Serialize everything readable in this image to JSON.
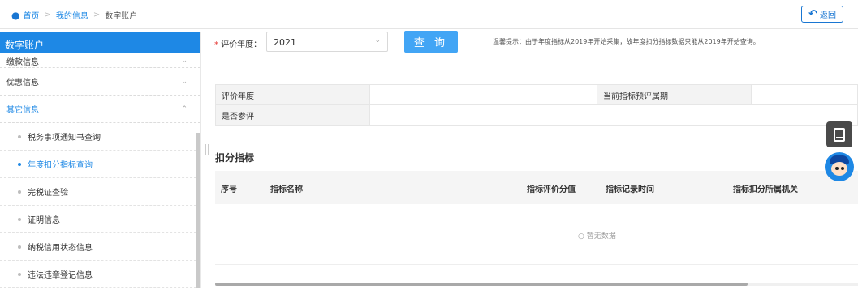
{
  "breadcrumb": {
    "home": "首页",
    "my_info": "我的信息",
    "current": "数字账户",
    "sep": ">"
  },
  "back_button": {
    "label": "返回"
  },
  "sidebar": {
    "title": "数字账户",
    "groups": [
      {
        "label": "缴款信息"
      },
      {
        "label": "优惠信息"
      },
      {
        "label": "其它信息"
      }
    ],
    "sub_items": [
      {
        "label": "税务事项通知书查询"
      },
      {
        "label": "年度扣分指标查询"
      },
      {
        "label": "完税证查验"
      },
      {
        "label": "证明信息"
      },
      {
        "label": "纳税信用状态信息"
      },
      {
        "label": "违法违章登记信息"
      }
    ]
  },
  "form": {
    "required_mark": "*",
    "year_label": "评价年度：",
    "year_value": "2021",
    "query_label": "查 询",
    "tip": "温馨提示：由于年度指标从2019年开始采集，故年度扣分指标数据只能从2019年开始查询。"
  },
  "info_table": {
    "row1_label": "评价年度",
    "row1_value": "",
    "row1_label2": "当前指标预评属期",
    "row1_value2": "",
    "row2_label": "是否参评",
    "row2_value": ""
  },
  "section": {
    "title": "扣分指标"
  },
  "grid": {
    "columns": [
      "序号",
      "指标名称",
      "指标评价分值",
      "指标记录时间",
      "指标扣分所属机关"
    ],
    "empty_text": "暂无数据"
  },
  "colors": {
    "accent": "#1e88e5",
    "button": "#42a5f5",
    "required": "#e53935"
  }
}
